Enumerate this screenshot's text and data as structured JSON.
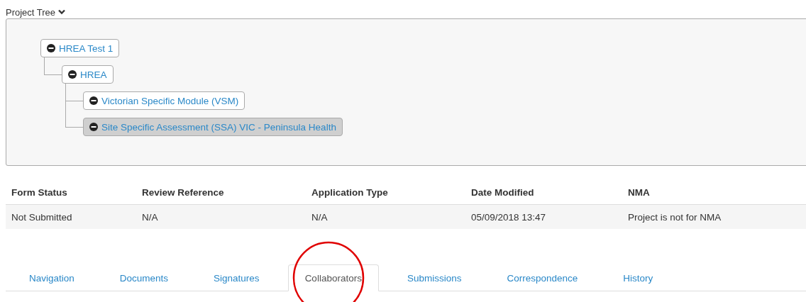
{
  "project_tree": {
    "title": "Project Tree",
    "nodes": [
      {
        "label": "HREA Test 1",
        "expanded": true,
        "selected": false,
        "children": [
          {
            "label": "HREA",
            "expanded": true,
            "selected": false,
            "children": [
              {
                "label": "Victorian Specific Module (VSM)",
                "expanded": true,
                "selected": false
              },
              {
                "label": "Site Specific Assessment (SSA) VIC - Peninsula Health",
                "expanded": true,
                "selected": true
              }
            ]
          }
        ]
      }
    ]
  },
  "table": {
    "columns": [
      "Form Status",
      "Review Reference",
      "Application Type",
      "Date Modified",
      "NMA"
    ],
    "rows": [
      [
        "Not Submitted",
        "N/A",
        "N/A",
        "05/09/2018 13:47",
        "Project is not for NMA"
      ]
    ]
  },
  "tabs": [
    {
      "label": "Navigation",
      "selected": false
    },
    {
      "label": "Documents",
      "selected": false
    },
    {
      "label": "Signatures",
      "selected": false
    },
    {
      "label": "Collaborators",
      "selected": true
    },
    {
      "label": "Submissions",
      "selected": false
    },
    {
      "label": "Correspondence",
      "selected": false
    },
    {
      "label": "History",
      "selected": false
    }
  ]
}
